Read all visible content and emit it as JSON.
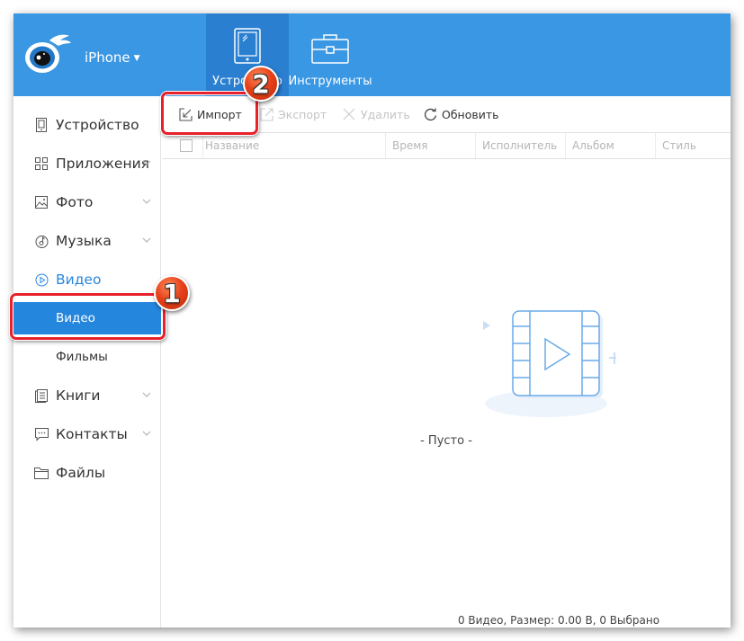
{
  "header": {
    "device_name": "iPhone",
    "tabs": [
      {
        "label": "Устройство",
        "icon": "tablet-icon",
        "active": true
      },
      {
        "label": "Инструменты",
        "icon": "toolbox-icon",
        "active": false
      }
    ],
    "colors": {
      "header_bg": "#3a97e3",
      "active_tab_bg": "#2a7fd0"
    }
  },
  "sidebar": {
    "items": [
      {
        "label": "Устройство",
        "icon": "device-icon",
        "has_chevron": false
      },
      {
        "label": "Приложения",
        "icon": "apps-grid-icon",
        "has_chevron": true
      },
      {
        "label": "Фото",
        "icon": "photo-icon",
        "has_chevron": true
      },
      {
        "label": "Музыка",
        "icon": "music-icon",
        "has_chevron": true
      },
      {
        "label": "Видео",
        "icon": "video-icon",
        "has_chevron": false,
        "expanded": true,
        "children": [
          {
            "label": "Видео",
            "selected": true
          },
          {
            "label": "Фильмы",
            "selected": false
          }
        ]
      },
      {
        "label": "Книги",
        "icon": "books-icon",
        "has_chevron": true
      },
      {
        "label": "Контакты",
        "icon": "contacts-icon",
        "has_chevron": true
      },
      {
        "label": "Файлы",
        "icon": "folder-icon",
        "has_chevron": false
      }
    ],
    "colors": {
      "selected_bg": "#2486dc",
      "expanded_text": "#2a86dc"
    }
  },
  "toolbar": {
    "import_label": "Импорт",
    "export_label": "Экспорт",
    "delete_label": "Удалить",
    "refresh_label": "Обновить"
  },
  "table": {
    "columns": [
      "Название",
      "Время",
      "Исполнитель",
      "Альбом",
      "Стиль"
    ],
    "rows": []
  },
  "empty_state": {
    "text": "- Пусто -"
  },
  "status_bar": {
    "text": "0 Видео, Размер: 0.00 B, 0 Выбрано"
  },
  "annotations": {
    "step1": "1",
    "step2": "2",
    "highlight_color": "#e8202a"
  }
}
